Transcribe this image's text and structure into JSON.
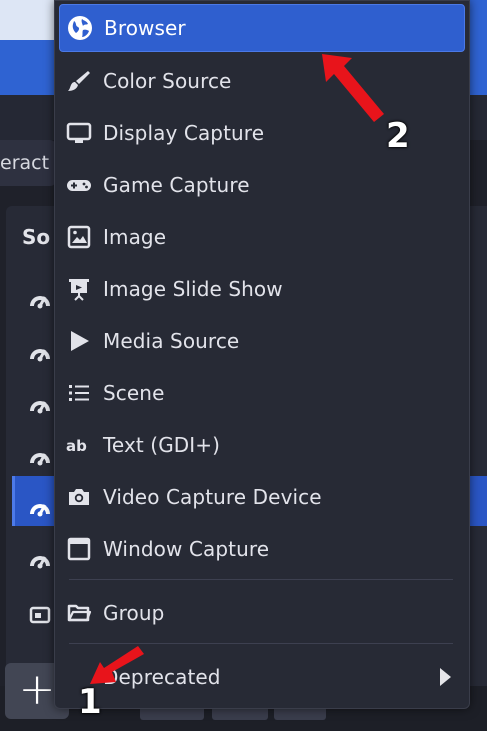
{
  "background": {
    "interact_button_label": "eract",
    "sources_dock_title": "So",
    "source_rows": [
      {
        "icon": "browser-icon"
      },
      {
        "icon": "browser-icon"
      },
      {
        "icon": "browser-icon"
      },
      {
        "icon": "browser-icon"
      },
      {
        "icon": "browser-icon",
        "selected": true
      },
      {
        "icon": "browser-icon"
      },
      {
        "icon": "window-capture-icon"
      }
    ],
    "add_button_label": "+"
  },
  "menu": {
    "items": [
      {
        "label": "Browser",
        "icon": "globe-icon",
        "active": true
      },
      {
        "label": "Color Source",
        "icon": "paint-brush-icon"
      },
      {
        "label": "Display Capture",
        "icon": "monitor-icon"
      },
      {
        "label": "Game Capture",
        "icon": "gamepad-icon"
      },
      {
        "label": "Image",
        "icon": "image-icon"
      },
      {
        "label": "Image Slide Show",
        "icon": "slideshow-icon"
      },
      {
        "label": "Media Source",
        "icon": "play-icon"
      },
      {
        "label": "Scene",
        "icon": "list-icon"
      },
      {
        "label": "Text (GDI+)",
        "icon": "text-ab-icon"
      },
      {
        "label": "Video Capture Device",
        "icon": "camera-icon"
      },
      {
        "label": "Window Capture",
        "icon": "window-icon"
      }
    ],
    "group": {
      "label": "Group",
      "icon": "folder-icon"
    },
    "deprecated": {
      "label": "Deprecated",
      "icon": "chevron-right-icon",
      "has_submenu": true
    }
  },
  "annotations": {
    "step1": "1",
    "step2": "2",
    "arrow_color": "#e8141b",
    "accent_color": "#2f5fcf"
  }
}
